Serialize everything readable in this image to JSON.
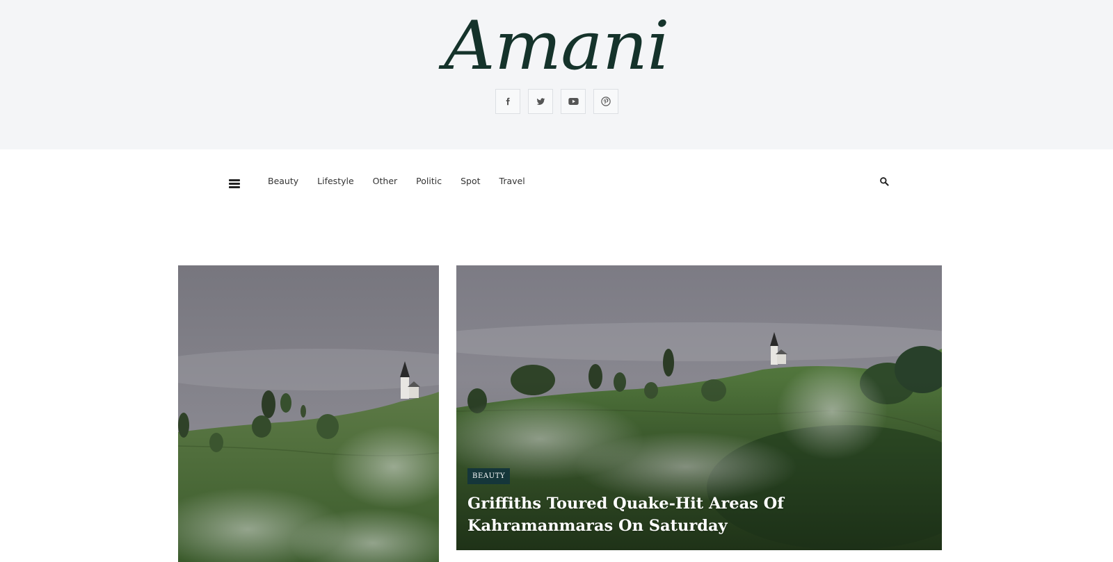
{
  "site": {
    "logo": "Amani",
    "social": [
      {
        "icon": "facebook-icon"
      },
      {
        "icon": "twitter-icon"
      },
      {
        "icon": "youtube-icon"
      },
      {
        "icon": "pinterest-icon"
      }
    ]
  },
  "nav": {
    "items": [
      {
        "label": "Beauty"
      },
      {
        "label": "Lifestyle"
      },
      {
        "label": "Other"
      },
      {
        "label": "Politic"
      },
      {
        "label": "Spot"
      },
      {
        "label": "Travel"
      }
    ],
    "menu_icon": "hamburger-menu-icon",
    "search_icon": "search-icon"
  },
  "featured": {
    "main_post": {
      "category": "BEAUTY",
      "title": "Griffiths Toured Quake-Hit Areas Of Kahramanmaras On Saturday"
    }
  },
  "colors": {
    "logo": "#15332b",
    "header_bg": "#f4f5f7",
    "badge_bg": "#15363a"
  }
}
